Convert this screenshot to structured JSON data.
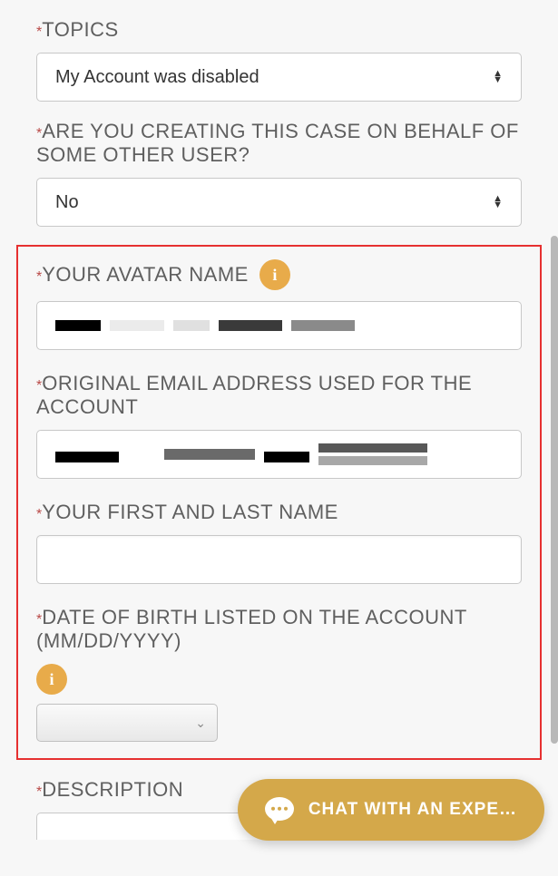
{
  "topics": {
    "label": "TOPICS",
    "value": "My Account was disabled"
  },
  "behalf": {
    "label": "ARE YOU CREATING THIS CASE ON BEHALF OF SOME OTHER USER?",
    "value": "No"
  },
  "avatar": {
    "label": "YOUR AVATAR NAME",
    "info_icon": "i"
  },
  "email": {
    "label": "ORIGINAL EMAIL ADDRESS USED FOR THE ACCOUNT"
  },
  "fullname": {
    "label": "YOUR FIRST AND LAST NAME",
    "value": ""
  },
  "dob": {
    "label": "DATE OF BIRTH LISTED ON THE ACCOUNT (MM/DD/YYYY)",
    "info_icon": "i",
    "value": ""
  },
  "description": {
    "label": "DESCRIPTION"
  },
  "chat": {
    "label": "CHAT WITH AN EXPE…"
  },
  "arrows": {
    "up": "▲",
    "down": "▼",
    "chevron": "⌄"
  }
}
